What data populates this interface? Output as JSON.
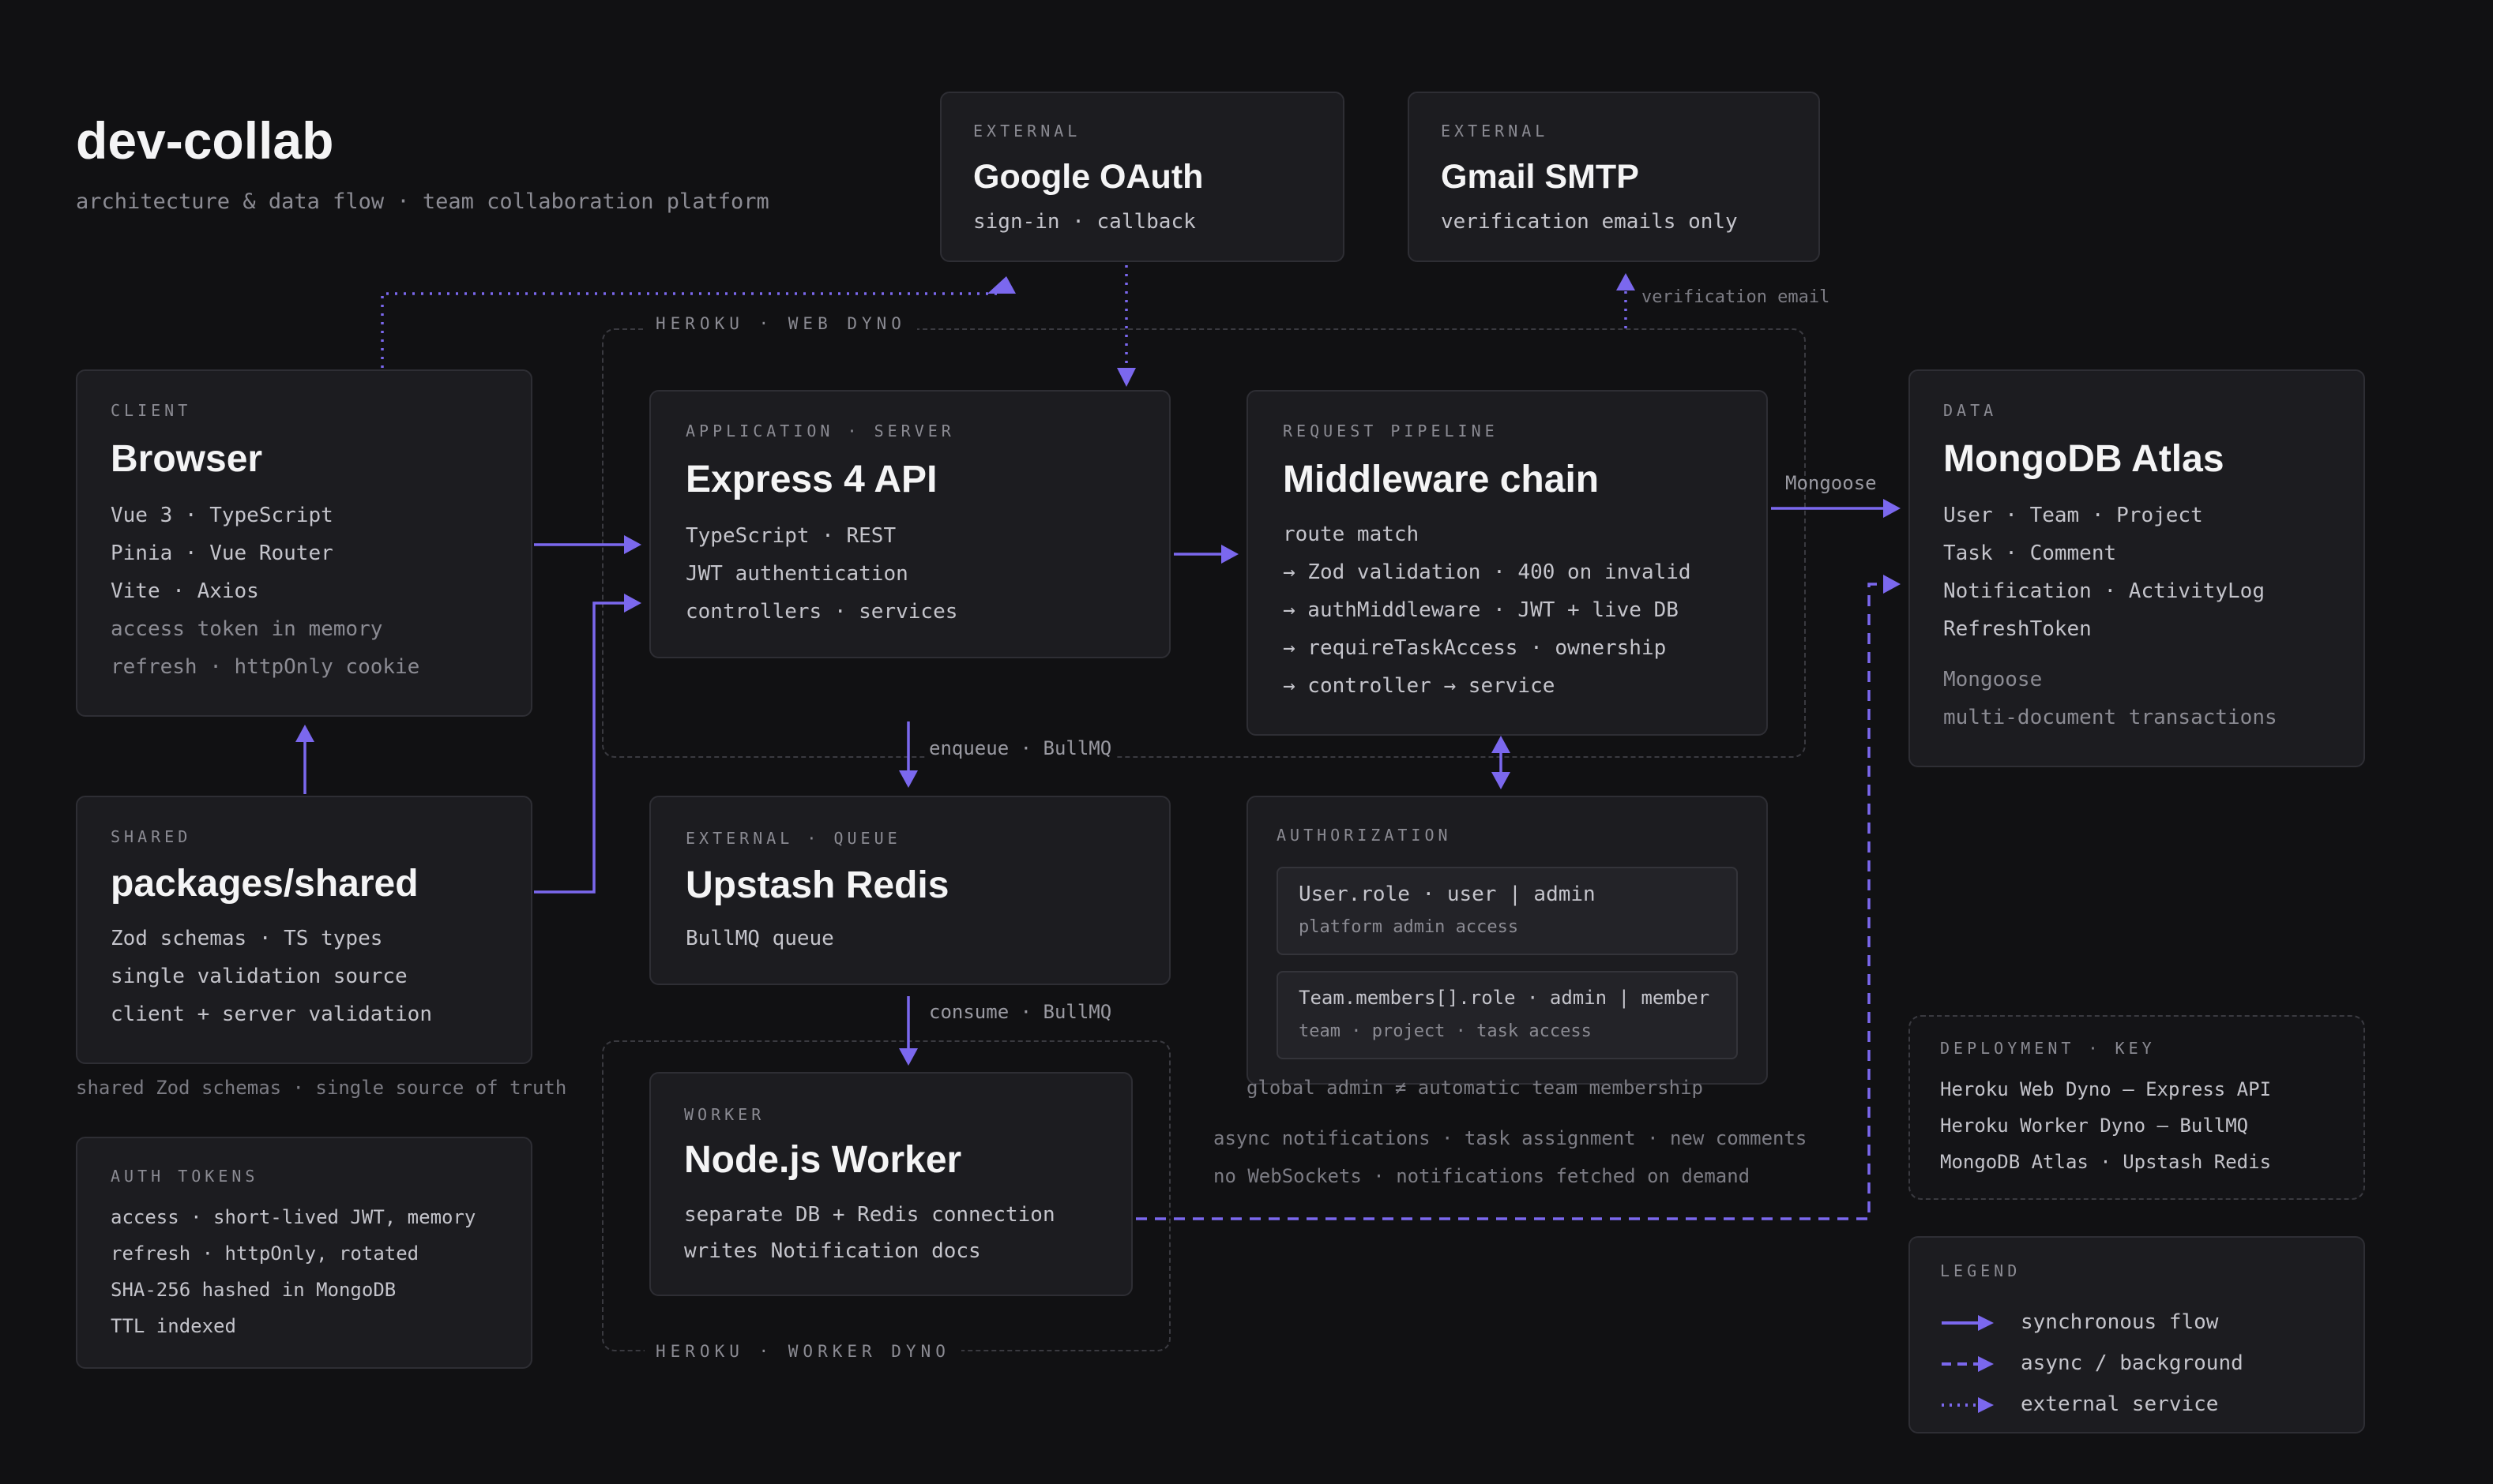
{
  "header": {
    "title": "dev-collab",
    "subtitle": "architecture & data flow · team collaboration platform"
  },
  "colors": {
    "background": "#111113",
    "card": "#1c1c20",
    "accent": "#7b68ee",
    "text": "#f4f4f5",
    "muted": "#8b8b93"
  },
  "zones": {
    "web_dyno": "HEROKU · WEB DYNO",
    "worker_dyno": "HEROKU · WORKER DYNO"
  },
  "nodes": {
    "google_oauth": {
      "eyebrow": "EXTERNAL",
      "title": "Google OAuth",
      "lines": [
        "sign-in · callback"
      ]
    },
    "gmail_smtp": {
      "eyebrow": "EXTERNAL",
      "title": "Gmail SMTP",
      "lines": [
        "verification emails only"
      ]
    },
    "browser": {
      "eyebrow": "CLIENT",
      "title": "Browser",
      "lines": [
        "Vue 3 · TypeScript",
        "Pinia · Vue Router",
        "Vite · Axios"
      ],
      "dim_lines": [
        "access token in memory",
        "refresh · httpOnly cookie"
      ]
    },
    "express": {
      "eyebrow": "APPLICATION · SERVER",
      "title": "Express 4 API",
      "lines": [
        "TypeScript · REST",
        "JWT authentication",
        "controllers · services"
      ]
    },
    "middleware": {
      "eyebrow": "REQUEST PIPELINE",
      "title": "Middleware chain",
      "lines": [
        "route match",
        "→ Zod validation · 400 on invalid",
        "→ authMiddleware · JWT + live DB",
        "→ requireTaskAccess · ownership",
        "→ controller → service"
      ]
    },
    "mongodb": {
      "eyebrow": "DATA",
      "title": "MongoDB Atlas",
      "lines": [
        "User · Team · Project",
        "Task · Comment",
        "Notification · ActivityLog",
        "RefreshToken"
      ],
      "dim_lines": [
        "Mongoose",
        "multi-document transactions"
      ]
    },
    "shared": {
      "eyebrow": "SHARED",
      "title": "packages/shared",
      "lines": [
        "Zod schemas · TS types",
        "single validation source",
        "client + server validation"
      ]
    },
    "redis": {
      "eyebrow": "EXTERNAL · QUEUE",
      "title": "Upstash Redis",
      "lines": [
        "BullMQ queue"
      ]
    },
    "authorization": {
      "eyebrow": "AUTHORIZATION",
      "roles": [
        {
          "main": "User.role · user | admin",
          "sub": "platform admin access"
        },
        {
          "main": "Team.members[].role · admin | member",
          "sub": "team · project · task access"
        }
      ]
    },
    "worker": {
      "eyebrow": "WORKER",
      "title": "Node.js Worker",
      "lines": [
        "separate DB + Redis connection",
        "writes Notification docs"
      ]
    },
    "auth_tokens": {
      "eyebrow": "AUTH TOKENS",
      "lines": [
        "access · short-lived JWT, memory",
        "refresh · httpOnly, rotated",
        "SHA-256 hashed in MongoDB",
        "TTL indexed"
      ]
    },
    "deployment": {
      "eyebrow": "DEPLOYMENT · KEY",
      "lines": [
        "Heroku Web Dyno — Express API",
        "Heroku Worker Dyno — BullMQ",
        "MongoDB Atlas · Upstash Redis"
      ]
    }
  },
  "edge_labels": {
    "verification_email": "verification email",
    "mongoose": "Mongoose",
    "enqueue": "enqueue · BullMQ",
    "consume": "consume · BullMQ"
  },
  "notes": {
    "shared_note": "shared Zod schemas · single source of truth",
    "admin_note": "global admin ≠ automatic team membership",
    "async_1": "async notifications · task assignment · new comments",
    "async_2": "no WebSockets · notifications fetched on demand"
  },
  "legend": {
    "title": "LEGEND",
    "items": [
      {
        "label": "synchronous flow",
        "style": "solid"
      },
      {
        "label": "async / background",
        "style": "dashed"
      },
      {
        "label": "external service",
        "style": "dotted"
      }
    ]
  }
}
